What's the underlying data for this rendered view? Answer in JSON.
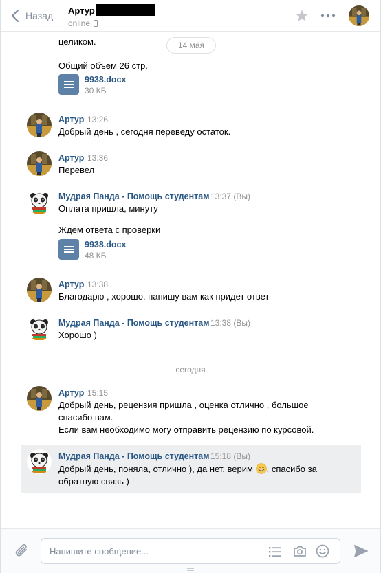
{
  "header": {
    "back_label": "Назад",
    "peer_name": "Артур",
    "peer_status": "online"
  },
  "messages_area": {
    "date_pill": "14 мая",
    "date_today": "сегодня"
  },
  "messages": [
    {
      "text": "целиком."
    },
    {
      "text": "Общий объем 26 стр."
    },
    {
      "doc": {
        "name": "9938.docx",
        "size": "30 КБ"
      }
    },
    {
      "author": "Артур",
      "time": "13:26",
      "text": "Добрый день , сегодня переведу остаток."
    },
    {
      "author": "Артур",
      "time": "13:36",
      "text": "Перевел"
    },
    {
      "author": "Мудрая Панда - Помощь студентам",
      "time": "13:37",
      "suffix": "(Вы)",
      "text1": "Оплата пришла, минуту",
      "text2": "Ждем ответа с проверки",
      "doc": {
        "name": "9938.docx",
        "size": "48 КБ"
      }
    },
    {
      "author": "Артур",
      "time": "13:38",
      "text": "Благодарю , хорошо, напишу вам как придет ответ"
    },
    {
      "author": "Мудрая Панда - Помощь студентам",
      "time": "13:38",
      "suffix": "(Вы)",
      "text": "Хорошо )"
    },
    {
      "author": "Артур",
      "time": "15:15",
      "line1": "Добрый день, рецензия пришла , оценка отлично , большое",
      "line2": "спасибо вам.",
      "line3": "Если вам необходимо могу отправить рецензию по курсовой."
    },
    {
      "author": "Мудрая Панда - Помощь студентам",
      "time": "15:18",
      "suffix": "(Вы)",
      "line1a": "Добрый день, поняла, отлично ), да нет, верим",
      "line1b": ", спасибо за",
      "line2": "обратную связь )"
    }
  ],
  "composer": {
    "placeholder": "Напишите сообщение..."
  },
  "colors": {
    "link": "#2a5885",
    "muted": "#939393",
    "doc_icon": "#5e81a8",
    "highlight_bg": "#edeef0"
  },
  "icons": [
    "chevron-left-icon",
    "phone-icon",
    "star-icon",
    "more-dots-icon",
    "document-icon",
    "paperclip-icon",
    "list-icon",
    "camera-icon",
    "smile-icon",
    "send-icon"
  ]
}
